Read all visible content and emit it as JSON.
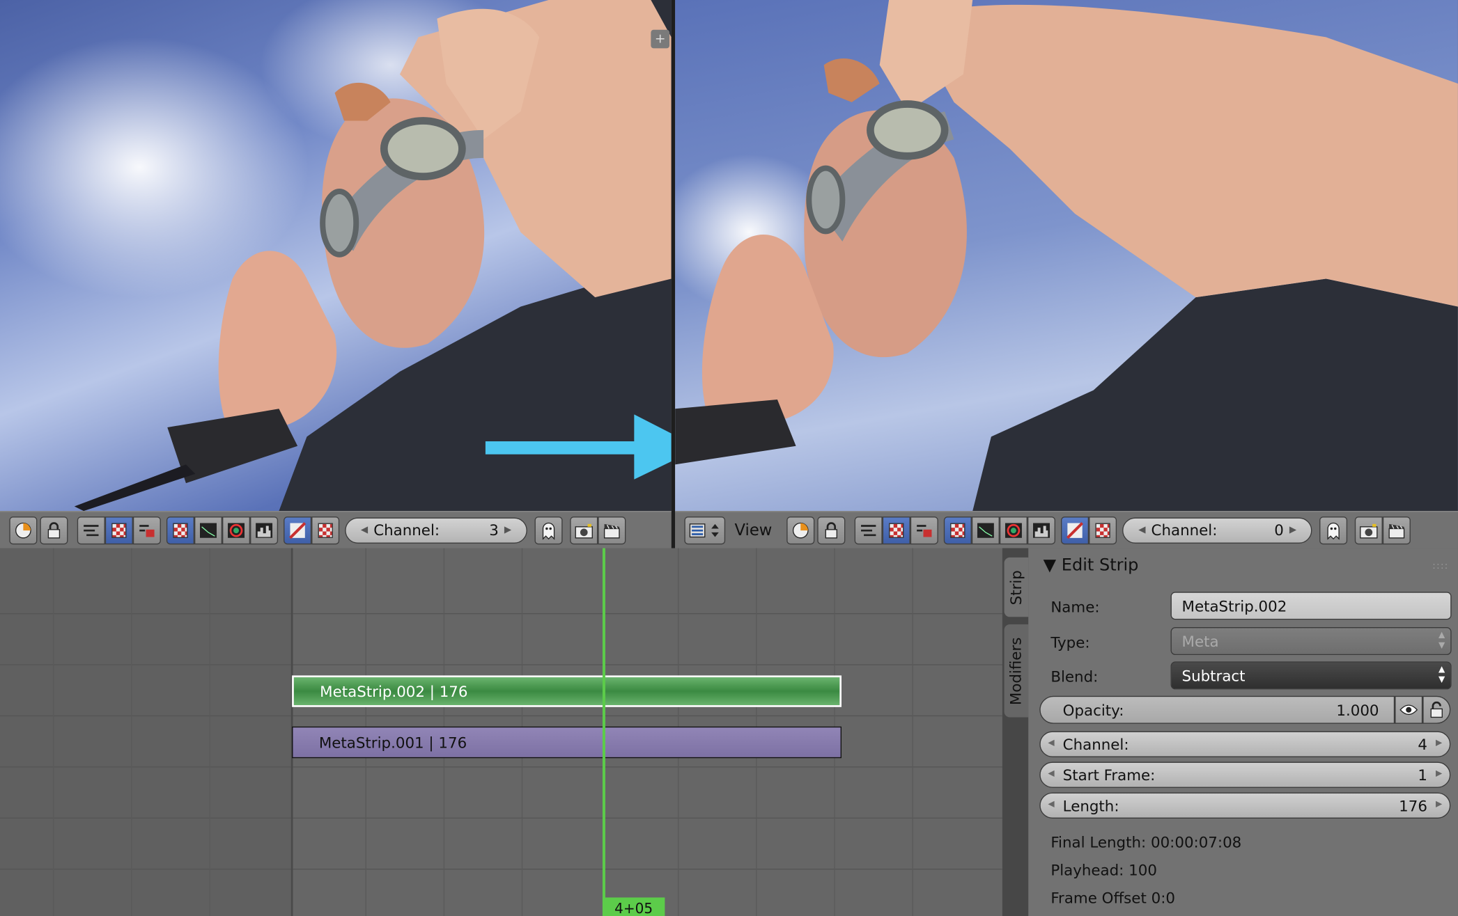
{
  "left_header": {
    "channel_label": "Channel:",
    "channel_value": "3"
  },
  "right_header": {
    "view_menu": "View",
    "channel_label": "Channel:",
    "channel_value": "0"
  },
  "timeline": {
    "strips": [
      {
        "label": "MetaStrip.002 | 176",
        "color": "#4d9a52",
        "selected": true
      },
      {
        "label": "MetaStrip.001 | 176",
        "color": "#8579ab",
        "selected": false
      }
    ],
    "playhead_label": "4+05",
    "playhead_color": "#5ccc4a"
  },
  "sidebar_tabs": {
    "strip": "Strip",
    "modifiers": "Modifiers"
  },
  "edit_strip": {
    "title": "Edit Strip",
    "name_label": "Name:",
    "name_value": "MetaStrip.002",
    "type_label": "Type:",
    "type_value": "Meta",
    "blend_label": "Blend:",
    "blend_value": "Subtract",
    "opacity_label": "Opacity:",
    "opacity_value": "1.000",
    "channel_label": "Channel:",
    "channel_value": "4",
    "start_label": "Start Frame:",
    "start_value": "1",
    "length_label": "Length:",
    "length_value": "176",
    "final_length": "Final Length: 00:00:07:08",
    "playhead": "Playhead: 100",
    "frame_offset": "Frame Offset 0:0"
  },
  "icons": [
    "scope-icon",
    "lock-icon",
    "waveform-icon",
    "checker-icon",
    "view-mode-icon",
    "image-icon",
    "vectorscope-icon",
    "histogram-icon",
    "overlay-icon",
    "ghost-icon",
    "camera-icon",
    "clapper-icon",
    "sequencer-editor-icon",
    "eye-icon",
    "lock-open-icon"
  ],
  "arrow_color": "#4cc6f0"
}
